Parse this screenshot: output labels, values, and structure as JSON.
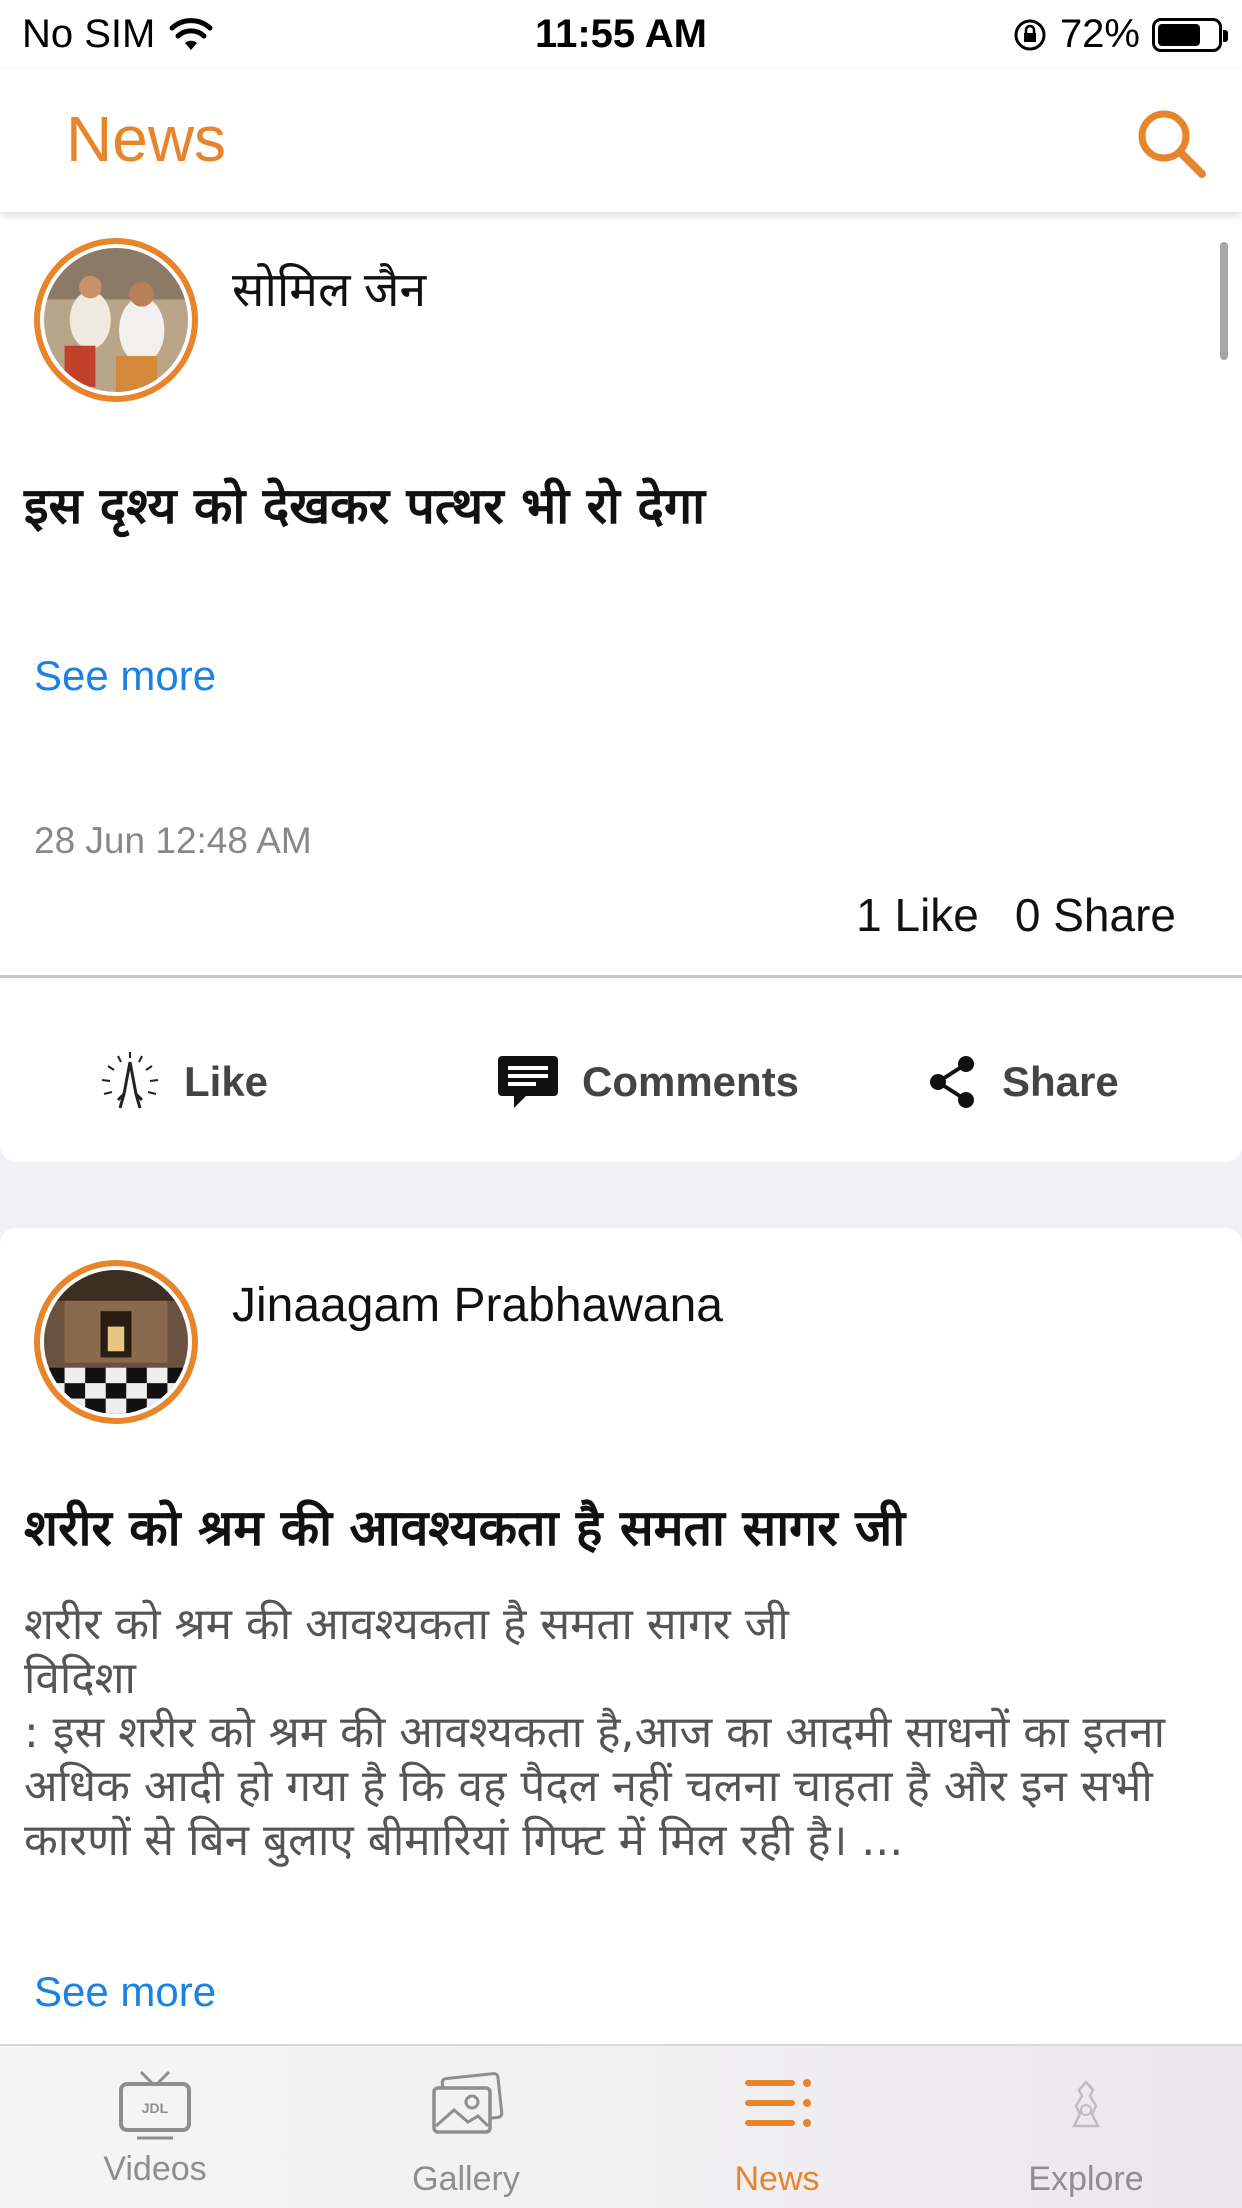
{
  "status_bar": {
    "carrier": "No SIM",
    "time": "11:55 AM",
    "battery_percent": "72%",
    "battery_level": 0.72
  },
  "header": {
    "title": "News",
    "search_icon": "search-icon"
  },
  "colors": {
    "accent": "#e8842a",
    "link": "#1a82e2",
    "background": "#f1f1f5"
  },
  "posts": [
    {
      "author": "सोमिल जैन",
      "headline": "इस दृश्य को देखकर पत्थर भी रो देगा",
      "body": "",
      "see_more": "See more",
      "timestamp": "28 Jun 12:48 AM",
      "likes": "1 Like",
      "shares": "0 Share",
      "actions": {
        "like": "Like",
        "comments": "Comments",
        "share": "Share"
      }
    },
    {
      "author": "Jinaagam Prabhawana",
      "headline": "शरीर को श्रम की आवश्यकता है समता सागर जी",
      "body": "शरीर को श्रम की आवश्यकता है समता सागर जी\n   विदिशा\n: इस शरीर को श्रम की आवश्यकता है,आज का आदमी साधनों का इतना अधिक आदी हो गया है कि वह पैदल नहीं चलना चाहता है और इन सभी कारणों से बिन बुलाए बीमारियां गिफ्ट में मिल रही है। ...",
      "see_more": "See more"
    }
  ],
  "tabs": [
    {
      "label": "Videos",
      "icon": "tv-icon",
      "active": false
    },
    {
      "label": "Gallery",
      "icon": "gallery-icon",
      "active": false
    },
    {
      "label": "News",
      "icon": "news-list-icon",
      "active": true
    },
    {
      "label": "Explore",
      "icon": "explore-icon",
      "active": false
    }
  ],
  "tab_icon_text": "JDL"
}
